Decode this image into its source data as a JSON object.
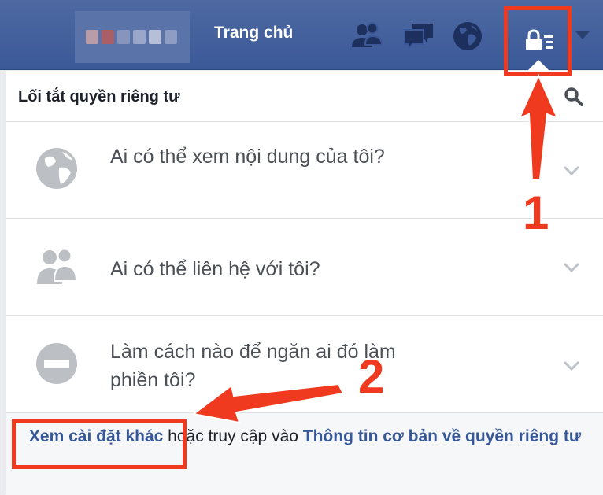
{
  "topbar": {
    "home_label": "Trang chủ",
    "colors": {
      "bar": "#3b5998",
      "icon": "#1d2f5c"
    }
  },
  "panel": {
    "title": "Lối tắt quyền riêng tư",
    "rows": [
      {
        "label": "Ai có thể xem nội dung của tôi?",
        "icon": "globe-icon"
      },
      {
        "label": "Ai có thể liên hệ với tôi?",
        "icon": "people-icon"
      },
      {
        "label": "Làm cách nào để ngăn ai đó làm phiền tôi?",
        "icon": "block-icon"
      }
    ],
    "footer": {
      "more_settings_link": "Xem cài đặt khác",
      "middle_text": " hoặc truy cập vào ",
      "privacy_basics_link": "Thông tin cơ bản về quyền riêng tư"
    }
  },
  "annotations": {
    "step1": "1",
    "step2": "2",
    "color": "#f03a1f"
  }
}
